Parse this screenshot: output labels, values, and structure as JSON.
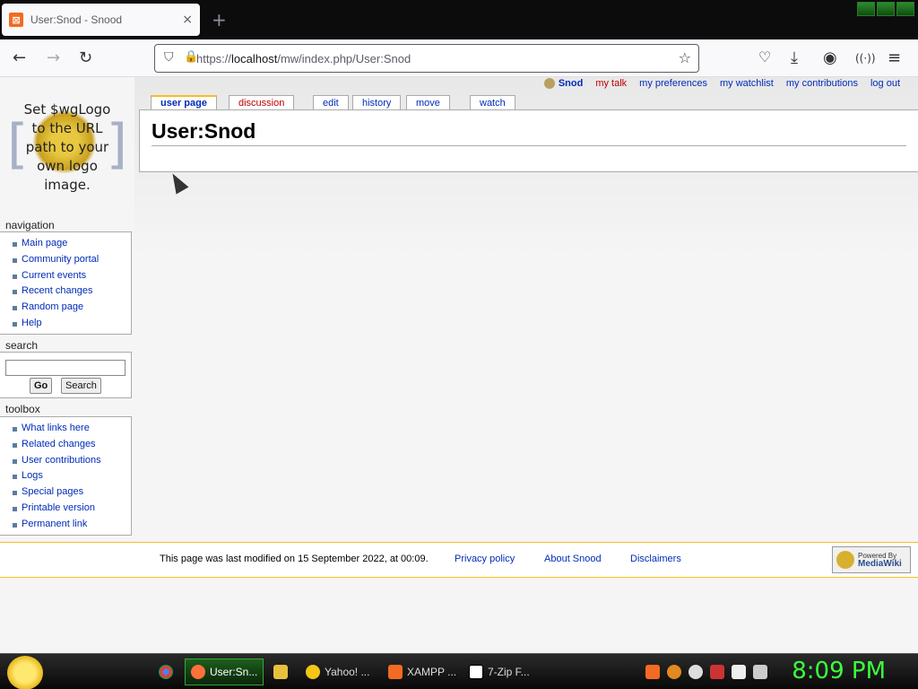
{
  "browser": {
    "tab_title": "User:Snod - Snood",
    "tab_close": "×",
    "new_tab": "+",
    "url_prefix": "https://",
    "url_host": "localhost",
    "url_path": "/mw/index.php/User:Snod"
  },
  "logo": {
    "text_line1": "Set $wgLogo",
    "text_line2": "to the URL",
    "text_line3": "path to your",
    "text_line4": "own logo",
    "text_line5": "image."
  },
  "personal_tools": {
    "user": "Snod",
    "talk": "my talk",
    "preferences": "my preferences",
    "watchlist": "my watchlist",
    "contributions": "my contributions",
    "logout": "log out"
  },
  "content_tabs": {
    "user_page": "user page",
    "discussion": "discussion",
    "edit": "edit",
    "history": "history",
    "move": "move",
    "watch": "watch"
  },
  "page": {
    "heading": "User:Snod"
  },
  "navigation": {
    "title": "navigation",
    "items": [
      "Main page",
      "Community portal",
      "Current events",
      "Recent changes",
      "Random page",
      "Help"
    ]
  },
  "search": {
    "title": "search",
    "go": "Go",
    "search": "Search"
  },
  "toolbox": {
    "title": "toolbox",
    "items": [
      "What links here",
      "Related changes",
      "User contributions",
      "Logs",
      "Special pages",
      "Printable version",
      "Permanent link"
    ]
  },
  "footer": {
    "last_modified": "This page was last modified on 15 September 2022, at 00:09.",
    "privacy": "Privacy policy",
    "about": "About Snood",
    "disclaimers": "Disclaimers",
    "powered_by": "Powered By",
    "mediawiki": "MediaWiki"
  },
  "taskbar": {
    "firefox": "User:Sn...",
    "yahoo": "Yahoo! ...",
    "xampp": "XAMPP ...",
    "sevenzip": "7-Zip F...",
    "clock": "8:09 PM"
  }
}
